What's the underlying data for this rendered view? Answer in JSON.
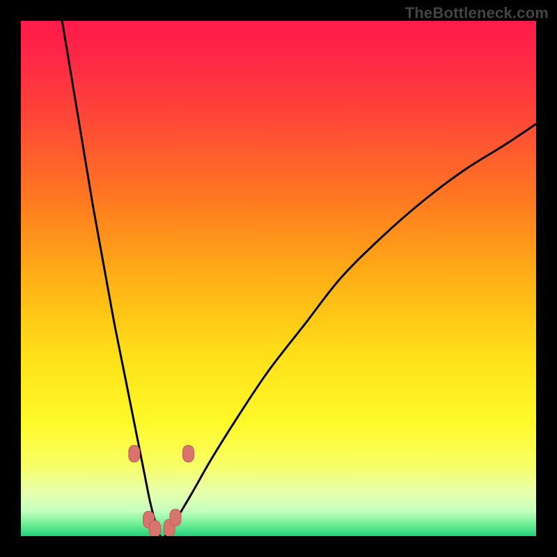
{
  "watermark": "TheBottleneck.com",
  "colors": {
    "frame": "#000000",
    "curve": "#000000",
    "marker_fill": "#d7746e",
    "marker_stroke": "#c45a53",
    "gradient_stops": [
      {
        "offset": 0.0,
        "color": "#ff1a4a"
      },
      {
        "offset": 0.08,
        "color": "#ff2a45"
      },
      {
        "offset": 0.2,
        "color": "#ff4a36"
      },
      {
        "offset": 0.35,
        "color": "#ff7a20"
      },
      {
        "offset": 0.5,
        "color": "#ffb015"
      },
      {
        "offset": 0.65,
        "color": "#ffe018"
      },
      {
        "offset": 0.78,
        "color": "#fff92a"
      },
      {
        "offset": 0.86,
        "color": "#f8ff62"
      },
      {
        "offset": 0.91,
        "color": "#e9ffa8"
      },
      {
        "offset": 0.95,
        "color": "#c8ffc0"
      },
      {
        "offset": 0.975,
        "color": "#77ef9a"
      },
      {
        "offset": 1.0,
        "color": "#22d07a"
      }
    ]
  },
  "chart_data": {
    "type": "line",
    "title": "",
    "xlabel": "",
    "ylabel": "",
    "xlim": [
      0,
      100
    ],
    "ylim": [
      0,
      100
    ],
    "grid": false,
    "legend": false,
    "series": [
      {
        "name": "curve",
        "x": [
          8,
          10,
          12,
          14,
          16,
          18,
          20,
          22,
          23,
          24,
          25,
          26,
          27,
          28,
          30,
          33,
          37,
          42,
          48,
          55,
          62,
          70,
          78,
          86,
          94,
          100
        ],
        "y": [
          100,
          88,
          76,
          64,
          53,
          42,
          32,
          22,
          17,
          12,
          7,
          3,
          0,
          0,
          3,
          8,
          15,
          23,
          32,
          41,
          50,
          58,
          65,
          71,
          76,
          80
        ]
      }
    ],
    "markers": [
      {
        "x": 22.0,
        "y": 16.0
      },
      {
        "x": 24.8,
        "y": 3.2
      },
      {
        "x": 26.0,
        "y": 1.4
      },
      {
        "x": 28.8,
        "y": 1.6
      },
      {
        "x": 30.0,
        "y": 3.6
      },
      {
        "x": 32.5,
        "y": 16.0
      }
    ],
    "note": "y is 'distance from optimum' (0 = green/good, 100 = red/bad); background is a vertical good→bad color ramp, not a data series."
  }
}
